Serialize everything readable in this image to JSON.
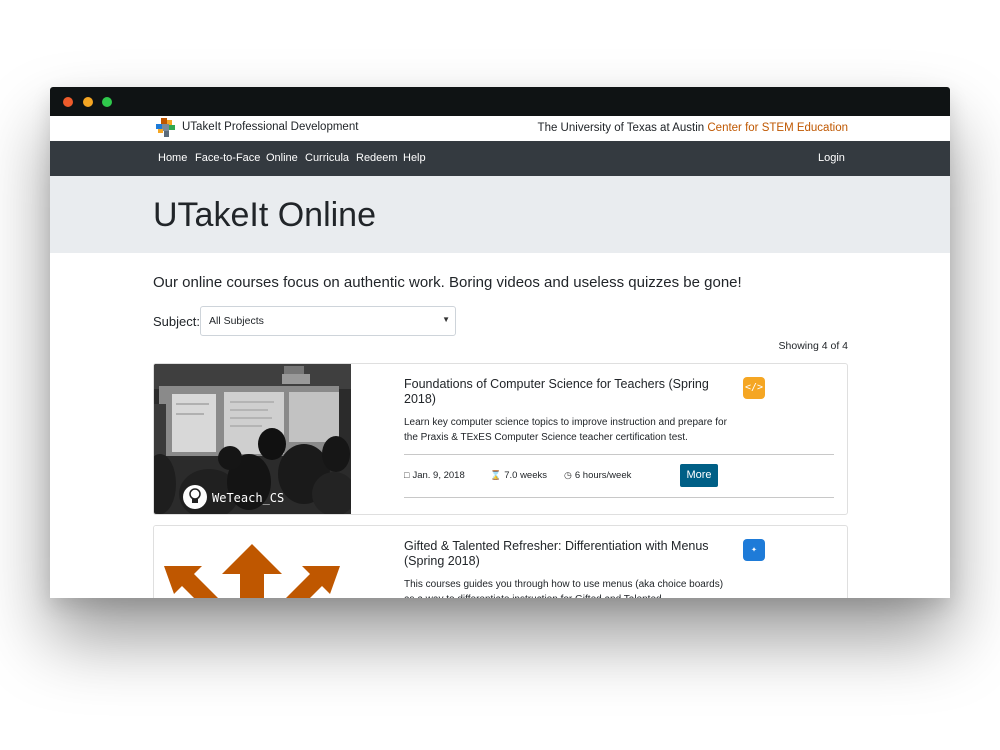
{
  "window_controls": [
    "close",
    "minimize",
    "maximize"
  ],
  "header": {
    "brand": "UTakeIt Professional Development",
    "university": "The University of Texas at Austin",
    "center": "Center for STEM Education"
  },
  "nav": {
    "items": [
      "Home",
      "Face-to-Face",
      "Online",
      "Curricula",
      "Redeem",
      "Help"
    ],
    "login": "Login"
  },
  "page": {
    "title": "UTakeIt Online",
    "lead": "Our online courses focus on authentic work. Boring videos and useless quizzes be gone!",
    "subject_label": "Subject:",
    "subject_selected": "All Subjects",
    "showing": "Showing 4 of 4"
  },
  "courses": [
    {
      "title": "Foundations of Computer Science for Teachers (Spring 2018)",
      "description": "Learn key computer science topics to improve instruction and prepare for the Praxis & TExES Computer Science teacher certification test.",
      "date": "Jan. 9, 2018",
      "duration": "7.0 weeks",
      "effort": "6 hours/week",
      "more_label": "More",
      "image_caption": "WeTeach_CS",
      "icon": "code-icon"
    },
    {
      "title": "Gifted & Talented Refresher: Differentiation with Menus (Spring 2018)",
      "description": "This courses guides you through how to use menus (aka choice boards) as a way to differentiate instruction for Gifted and Talented",
      "icon": "magic-wand-icon"
    }
  ],
  "colors": {
    "navbar": "#343a40",
    "jumbotron": "#e9ecef",
    "accent_orange": "#bf5700",
    "button_blue": "#005f86",
    "badge_code": "#f5a623",
    "badge_wand": "#1e7bd8"
  }
}
